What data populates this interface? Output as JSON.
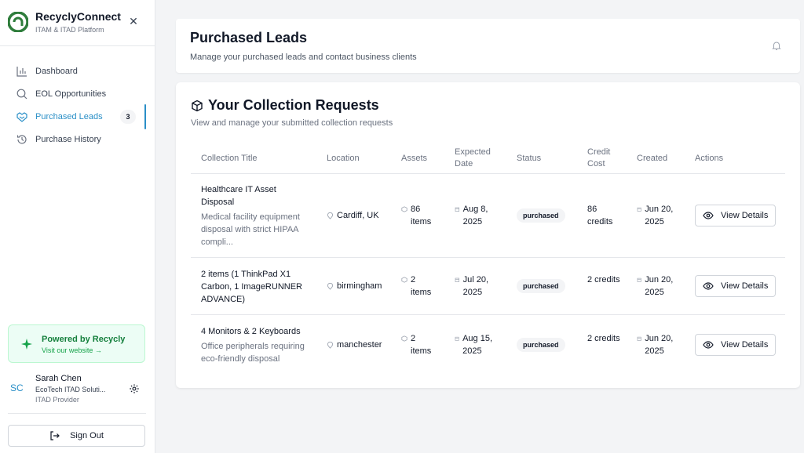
{
  "brand": {
    "name": "RecyclyConnect",
    "subtitle": "ITAM & ITAD Platform"
  },
  "nav": {
    "items": [
      {
        "label": "Dashboard",
        "icon": "bar-chart-icon"
      },
      {
        "label": "EOL Opportunities",
        "icon": "search-icon"
      },
      {
        "label": "Purchased Leads",
        "icon": "handshake-icon",
        "badge": "3",
        "active": true
      },
      {
        "label": "Purchase History",
        "icon": "history-icon"
      }
    ]
  },
  "powered": {
    "title": "Powered by Recycly",
    "link": "Visit our website →"
  },
  "user": {
    "initials": "SC",
    "name": "Sarah Chen",
    "company": "EcoTech ITAD Soluti...",
    "role": "ITAD Provider"
  },
  "signout_label": "Sign Out",
  "header": {
    "title": "Purchased Leads",
    "subtitle": "Manage your purchased leads and contact business clients"
  },
  "section": {
    "title": "Your Collection Requests",
    "subtitle": "View and manage your submitted collection requests"
  },
  "table": {
    "columns": [
      "Collection Title",
      "Location",
      "Assets",
      "Expected Date",
      "Status",
      "Credit Cost",
      "Created",
      "Actions"
    ],
    "rows": [
      {
        "title": "Healthcare IT Asset Disposal",
        "description": "Medical facility equipment disposal with strict HIPAA compli...",
        "location": "Cardiff, UK",
        "assets": "86 items",
        "expected": "Aug 8, 2025",
        "status": "purchased",
        "credits": "86 credits",
        "created": "Jun 20, 2025",
        "action": "View Details"
      },
      {
        "title": "2 items (1 ThinkPad X1 Carbon, 1 ImageRUNNER ADVANCE)",
        "description": "",
        "location": "birmingham",
        "assets": "2 items",
        "expected": "Jul 20, 2025",
        "status": "purchased",
        "credits": "2 credits",
        "created": "Jun 20, 2025",
        "action": "View Details"
      },
      {
        "title": "4 Monitors & 2 Keyboards",
        "description": "Office peripherals requiring eco-friendly disposal",
        "location": "manchester",
        "assets": "2 items",
        "expected": "Aug 15, 2025",
        "status": "purchased",
        "credits": "2 credits",
        "created": "Jun 20, 2025",
        "action": "View Details"
      }
    ]
  },
  "colors": {
    "accent": "#2a8fc7",
    "brand_green": "#15803d"
  }
}
